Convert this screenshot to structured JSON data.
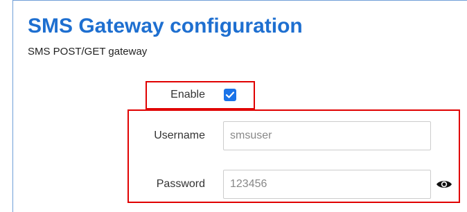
{
  "header": {
    "title": "SMS Gateway configuration",
    "subtitle": "SMS POST/GET gateway"
  },
  "form": {
    "enable": {
      "label": "Enable",
      "checked": true
    },
    "username": {
      "label": "Username",
      "value": "smsuser"
    },
    "password": {
      "label": "Password",
      "value": "123456",
      "toggle_icon": "eye-icon"
    }
  },
  "colors": {
    "title": "#1e6fd0",
    "highlight": "#e00000",
    "checkbox": "#1a73e8",
    "frame": "#6f9fd8"
  }
}
